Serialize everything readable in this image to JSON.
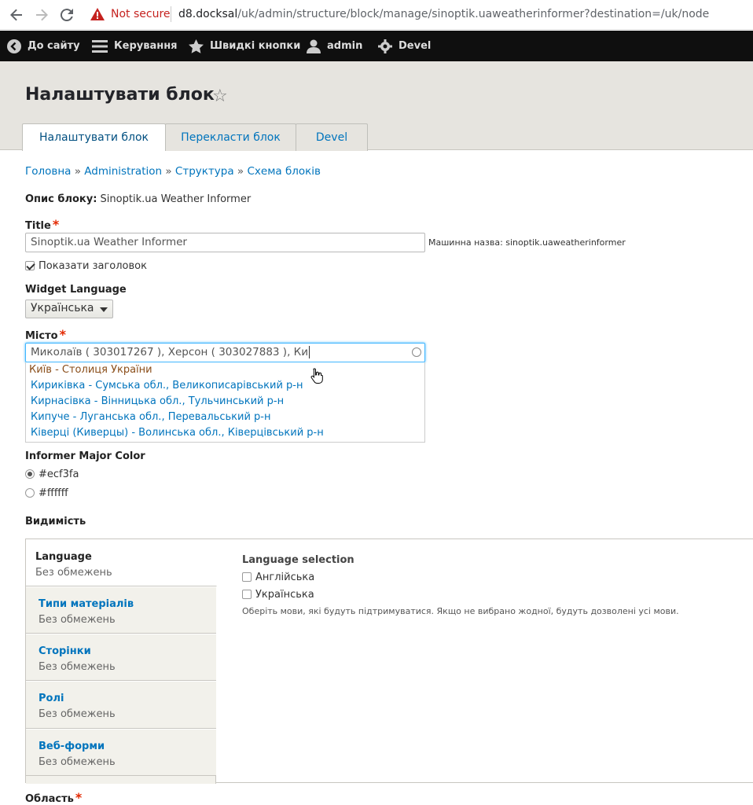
{
  "browser": {
    "not_secure": "Not secure",
    "url_host": "d8.docksal",
    "url_path": "/uk/admin/structure/block/manage/sinoptik.uaweatherinformer?destination=/uk/node"
  },
  "toolbar": {
    "items": [
      "До сайту",
      "Керування",
      "Швидкі кнопки",
      "admin",
      "Devel"
    ]
  },
  "header": {
    "title": "Налаштувати блок",
    "tabs": [
      "Налаштувати блок",
      "Перекласти блок",
      "Devel"
    ]
  },
  "breadcrumb": [
    "Головна",
    "Administration",
    "Структура",
    "Схема блоків"
  ],
  "form": {
    "description_label": "Опис блоку:",
    "description_value": "Sinoptik.ua Weather Informer",
    "title_label": "Title",
    "title_value": "Sinoptik.ua Weather Informer",
    "machine_name": "Машинна назва: sinoptik.uaweatherinformer",
    "show_title_label": "Показати заголовок",
    "widget_language_label": "Widget Language",
    "widget_language_value": "Українська",
    "city_label": "Місто",
    "city_value": "Миколаїв ( 303017267 ), Херсон ( 303027883 ), Ки",
    "autocomplete": [
      "Київ - Столиця України",
      "Кириківка - Сумська обл., Великописарівський р-н",
      "Кирнасівка - Вінницька обл., Тульчинський р-н",
      "Кипуче - Луганська обл., Перевальський р-н",
      "Ківерці (Киверцы) - Волинська обл., Ківерцівський р-н"
    ],
    "color_label": "Informer Major Color",
    "color_options": [
      "#ecf3fa",
      "#ffffff"
    ],
    "visibility_label": "Видимість",
    "region_label": "Область"
  },
  "visibility": {
    "tabs": [
      {
        "title": "Language",
        "summary": "Без обмежень"
      },
      {
        "title": "Типи матеріалів",
        "summary": "Без обмежень"
      },
      {
        "title": "Сторінки",
        "summary": "Без обмежень"
      },
      {
        "title": "Ролі",
        "summary": "Без обмежень"
      },
      {
        "title": "Веб-форми",
        "summary": "Без обмежень"
      }
    ],
    "pane_title": "Language selection",
    "options": [
      "Англійська",
      "Українська"
    ],
    "description": "Оберіть мови, які будуть підтримуватися. Якщо не вибрано жодної, будуть дозволені усі мови."
  }
}
